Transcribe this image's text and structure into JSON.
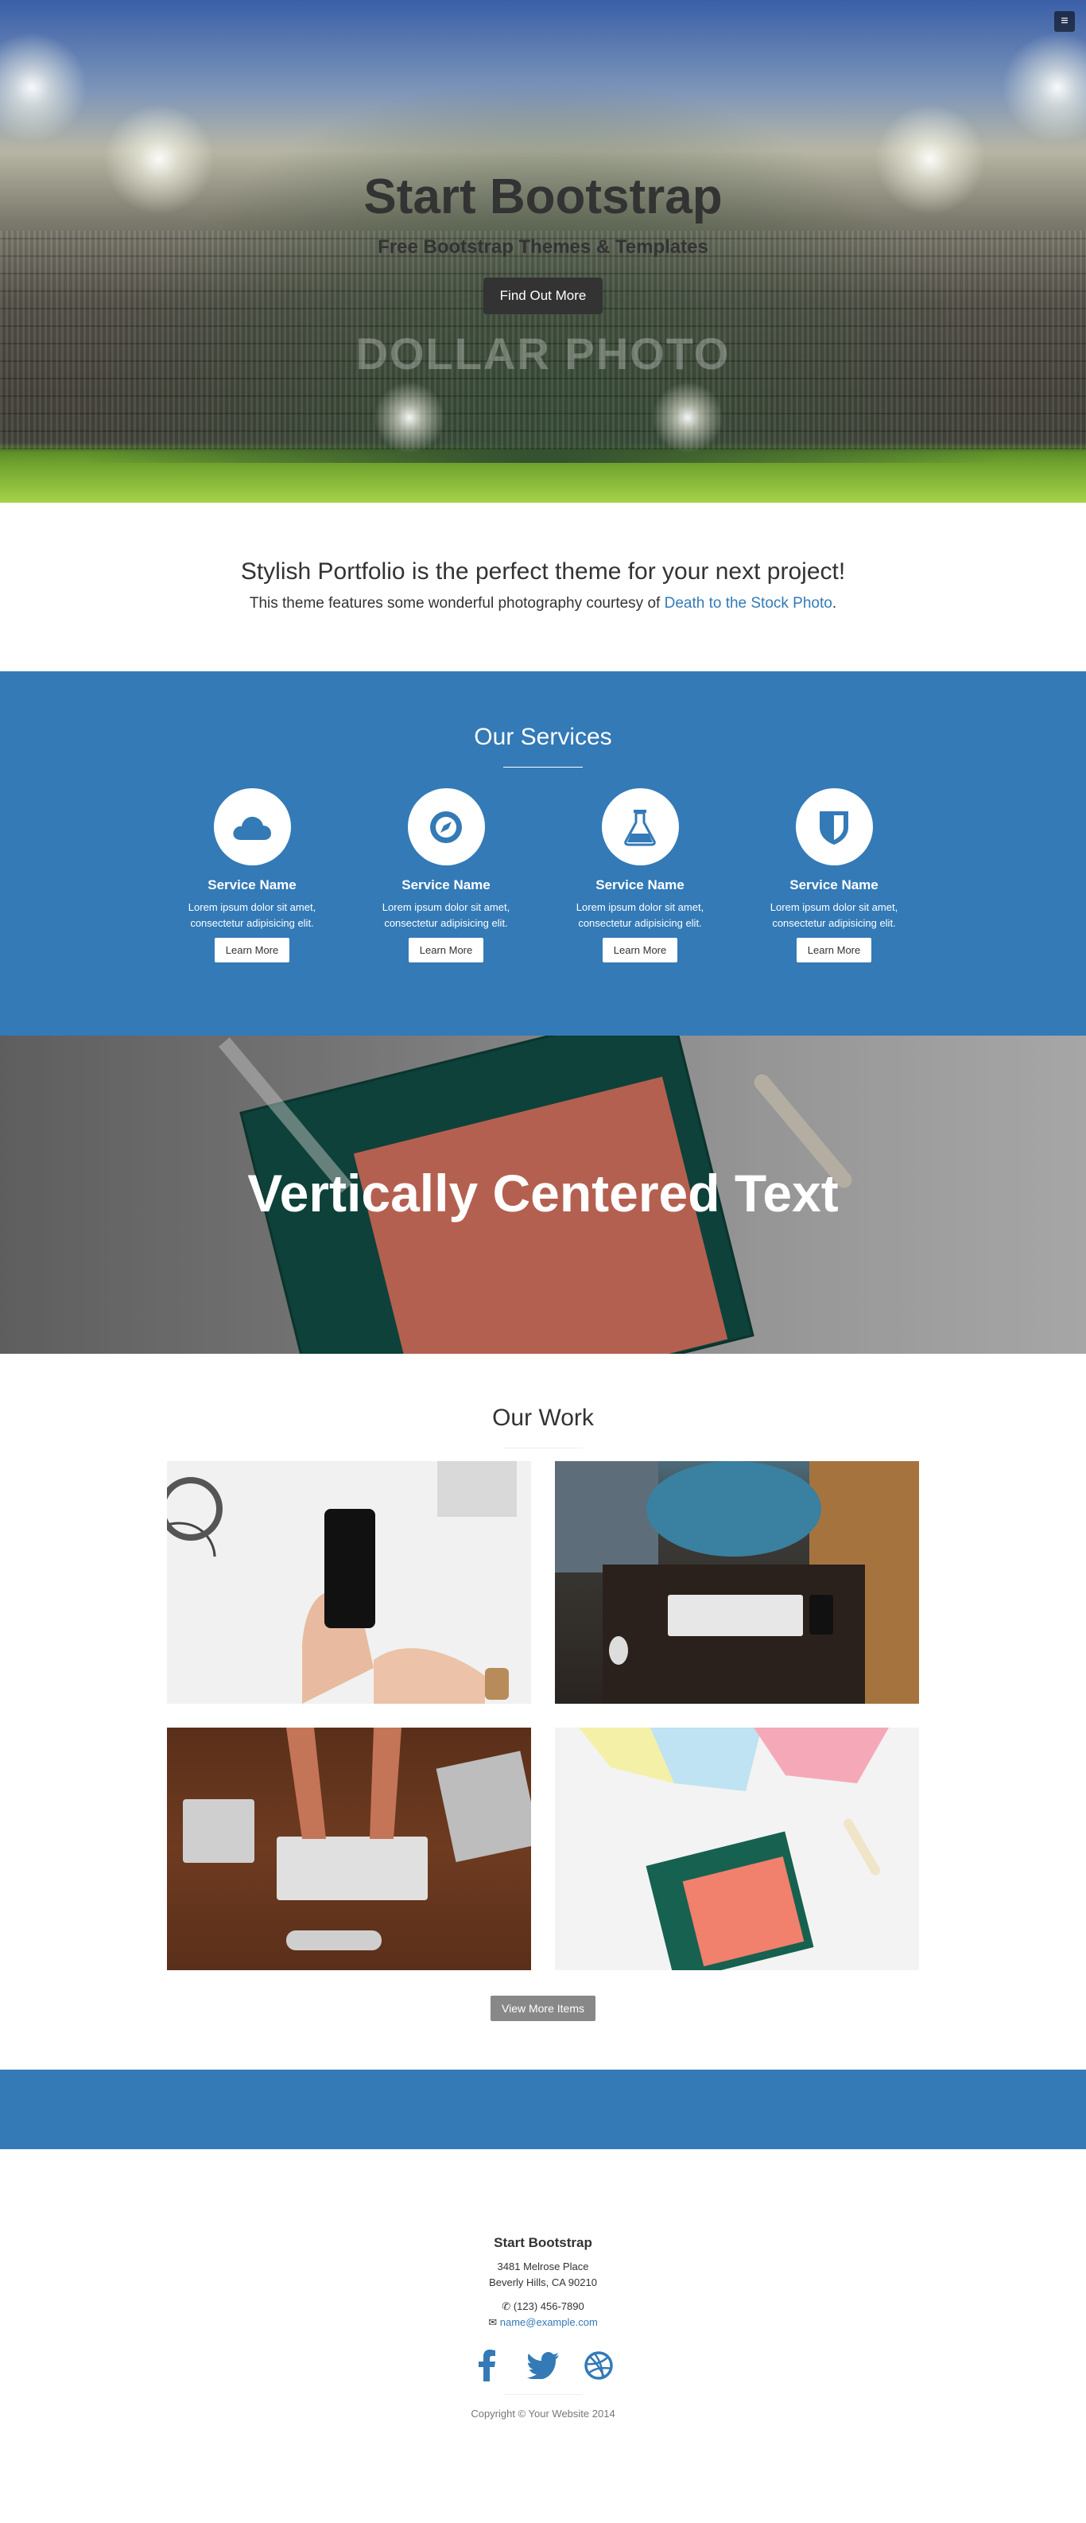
{
  "hero": {
    "title": "Start Bootstrap",
    "subtitle": "Free Bootstrap Themes & Templates",
    "button_label": "Find Out More",
    "watermark": "DOLLAR PHOTO"
  },
  "menu": {
    "icon": "menu-icon",
    "glyph": "≡"
  },
  "about": {
    "heading": "Stylish Portfolio is the perfect theme for your next project!",
    "text_prefix": "This theme features some wonderful photography courtesy of ",
    "link_text": "Death to the Stock Photo",
    "text_suffix": "."
  },
  "services": {
    "heading": "Our Services",
    "items": [
      {
        "icon": "cloud-icon",
        "name": "Service Name",
        "line1": "Lorem ipsum dolor sit amet,",
        "line2": "consectetur adipisicing elit.",
        "button": "Learn More"
      },
      {
        "icon": "compass-icon",
        "name": "Service Name",
        "line1": "Lorem ipsum dolor sit amet,",
        "line2": "consectetur adipisicing elit.",
        "button": "Learn More"
      },
      {
        "icon": "flask-icon",
        "name": "Service Name",
        "line1": "Lorem ipsum dolor sit amet,",
        "line2": "consectetur adipisicing elit.",
        "button": "Learn More"
      },
      {
        "icon": "shield-icon",
        "name": "Service Name",
        "line1": "Lorem ipsum dolor sit amet,",
        "line2": "consectetur adipisicing elit.",
        "button": "Learn More"
      }
    ],
    "accent_color": "#337ab7"
  },
  "callout": {
    "heading": "Vertically Centered Text"
  },
  "portfolio": {
    "heading": "Our Work",
    "items": [
      {
        "image": "phone-hands-photo"
      },
      {
        "image": "keyboard-desk-photo"
      },
      {
        "image": "typing-hands-photo"
      },
      {
        "image": "drawing-paper-photo"
      }
    ],
    "button": "View More Items"
  },
  "footer": {
    "title": "Start Bootstrap",
    "address_line1": "3481 Melrose Place",
    "address_line2": "Beverly Hills, CA 90210",
    "phone": "(123) 456-7890",
    "email": "name@example.com",
    "socials": [
      "facebook-icon",
      "twitter-icon",
      "dribbble-icon"
    ],
    "copyright": "Copyright © Your Website 2014"
  }
}
